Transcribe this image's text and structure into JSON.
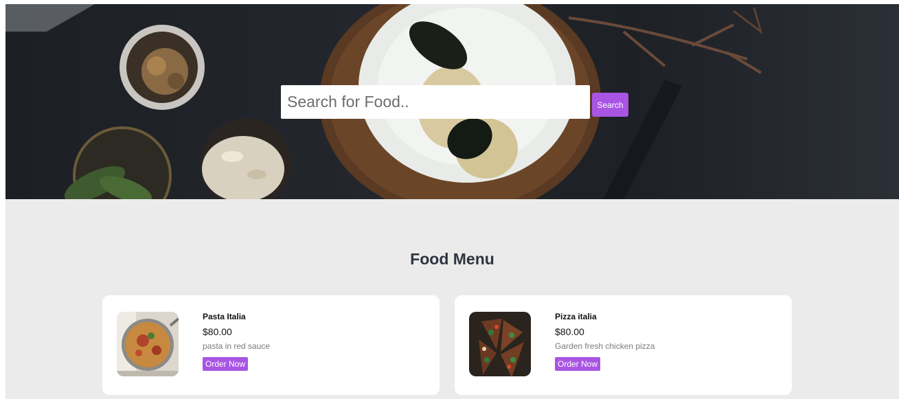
{
  "hero": {
    "search_placeholder": "Search for Food..",
    "search_button_label": "Search"
  },
  "menu": {
    "title": "Food Menu",
    "items": [
      {
        "name": "Pasta Italia",
        "price": "$80.00",
        "description": "pasta in red sauce",
        "order_label": "Order Now",
        "image_icon": "pasta-image"
      },
      {
        "name": "Pizza italia",
        "price": "$80.00",
        "description": "Garden fresh chicken pizza",
        "order_label": "Order Now",
        "image_icon": "pizza-image"
      }
    ]
  },
  "colors": {
    "accent": "#a855e4",
    "page_background": "#ebebeb",
    "hero_dark": "#1f2328"
  }
}
